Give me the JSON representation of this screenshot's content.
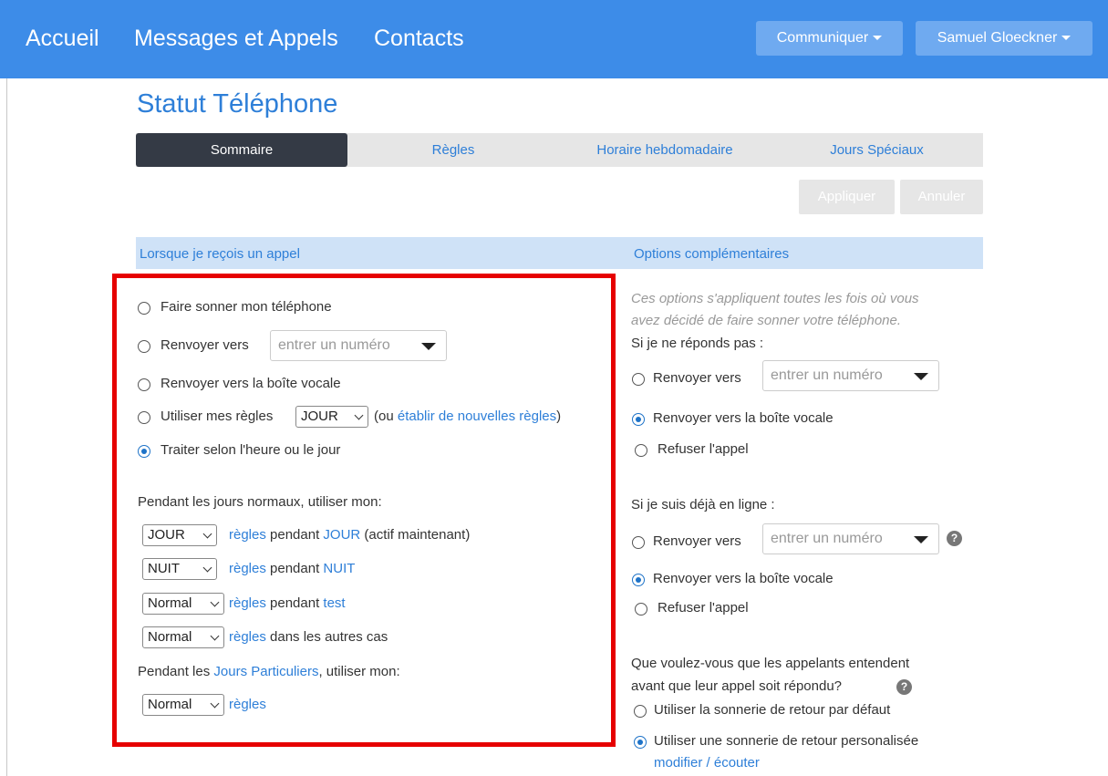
{
  "nav": {
    "home": "Accueil",
    "messages": "Messages et Appels",
    "contacts": "Contacts",
    "communicate": "Communiquer",
    "user": "Samuel Gloeckner"
  },
  "page": {
    "title": "Statut Téléphone"
  },
  "tabs": [
    "Sommaire",
    "Règles",
    "Horaire hebdomadaire",
    "Jours Spéciaux"
  ],
  "actions": {
    "apply": "Appliquer",
    "cancel": "Annuler"
  },
  "left": {
    "header": "Lorsque je reçois un appel",
    "opt_ring": "Faire sonner mon téléphone",
    "opt_forward": "Renvoyer vers",
    "number_placeholder": "entrer un numéro",
    "opt_voicemail": "Renvoyer vers la boîte vocale",
    "opt_rules": "Utiliser mes règles",
    "rules_select": "JOUR",
    "rules_paren_open": "(ou ",
    "rules_new_link": "établir de nouvelles règles",
    "rules_paren_close": ")",
    "opt_time": "Traiter selon l'heure ou le jour",
    "normal_days": "Pendant les jours normaux, utiliser mon:",
    "rows": [
      {
        "select": "JOUR",
        "rules": "règles",
        "mid": " pendant ",
        "link": "JOUR",
        "tail": " (actif maintenant)"
      },
      {
        "select": "NUIT",
        "rules": "règles",
        "mid": " pendant ",
        "link": "NUIT",
        "tail": ""
      },
      {
        "select": "Normal",
        "rules": "règles",
        "mid": " pendant ",
        "link": "test",
        "tail": ""
      },
      {
        "select": "Normal",
        "rules": "règles",
        "mid": " dans les autres cas",
        "link": "",
        "tail": ""
      }
    ],
    "special_prefix": "Pendant les ",
    "special_link": "Jours Particuliers",
    "special_suffix": ", utiliser mon:",
    "special_select": "Normal",
    "special_rules": "règles"
  },
  "right": {
    "header": "Options complémentaires",
    "note_line1": "Ces options s'appliquent toutes les fois où vous",
    "note_line2": "avez décidé de faire sonner votre téléphone.",
    "no_answer": "Si je ne réponds pas :",
    "forward": "Renvoyer vers",
    "number_placeholder": "entrer un numéro",
    "voicemail": "Renvoyer vers la boîte vocale",
    "refuse": "Refuser l'appel",
    "busy": "Si je suis déjà en ligne :",
    "help": "?",
    "ringback_q1": "Que voulez-vous que les appelants entendent",
    "ringback_q2": "avant que leur appel soit répondu?",
    "ringback_default": "Utiliser la sonnerie de retour par défaut",
    "ringback_custom": "Utiliser une sonnerie de retour personalisée",
    "modify_listen": "modifier / écouter"
  }
}
